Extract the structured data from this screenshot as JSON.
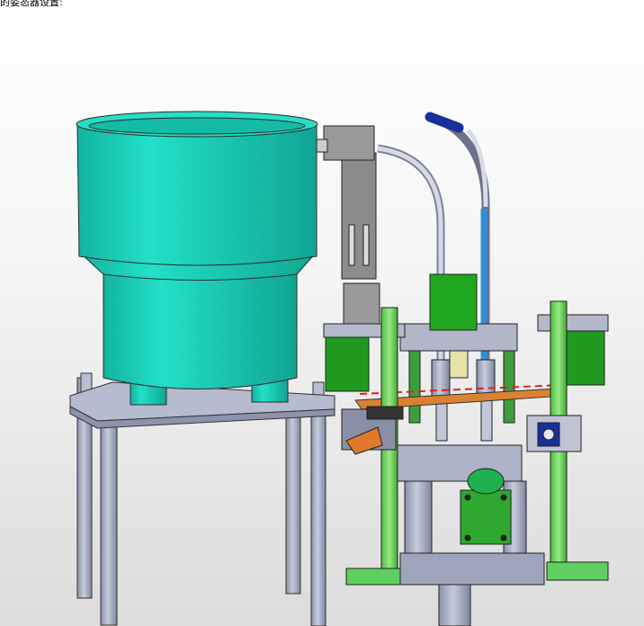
{
  "caption": "的姿态器设置:",
  "colors": {
    "bowl": "#1ad3bd",
    "bowl_shade": "#12a896",
    "steel": "#a8aec6",
    "steel_dark": "#7c8298",
    "green": "#6fd45c",
    "dark_green": "#1f9a1f",
    "blue_tube": "#2f8fd8",
    "orange": "#e07a2a",
    "red_dash": "#e02020",
    "navy": "#1a2f9a"
  },
  "parts": {
    "bowl": "vibratory-bowl-feeder",
    "stand": "feeder-stand",
    "tube_gray": "feed-tube",
    "tube_blue": "air-tube",
    "motor": "stepper-motor"
  }
}
